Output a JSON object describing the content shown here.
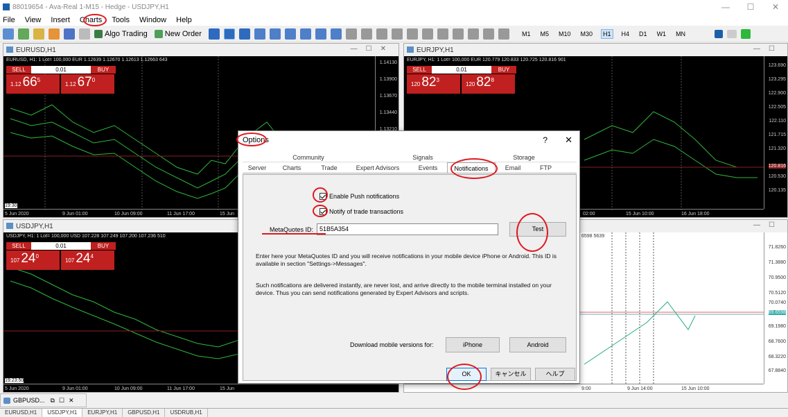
{
  "titlebar": {
    "title": "88019654 - Ava-Real 1-M15 - Hedge - USDJPY,H1",
    "minimize": "—",
    "maximize": "☐",
    "close": "✕"
  },
  "menu": [
    "File",
    "View",
    "Insert",
    "Charts",
    "Tools",
    "Window",
    "Help"
  ],
  "toolbar": {
    "algo_trading": "Algo Trading",
    "new_order": "New Order",
    "timeframes": [
      "M1",
      "M5",
      "M10",
      "M30",
      "H1",
      "H4",
      "D1",
      "W1",
      "MN"
    ],
    "active_timeframe": "H1"
  },
  "charts": {
    "eurusd": {
      "title": "EURUSD,H1",
      "info": "EURUSD, H1: 1 Lot= 100,000 EUR  1.12639 1.12670 1.12613 1.12663  643",
      "sell": "SELL",
      "buy": "BUY",
      "lot": "0.01",
      "bid_small": "1.12",
      "bid_big": "66",
      "bid_sup": "5",
      "ask_small": "1.12",
      "ask_big": "67",
      "ask_sup": "0",
      "yticks": [
        "1.14130",
        "1.13900",
        "1.13670",
        "1.13440",
        "1.13210"
      ],
      "xticks": [
        "5 Jun 2020",
        "9 Jun 01:00",
        "10 Jun 09:00",
        "11 Jun 17:00",
        "15 Jun"
      ],
      "cursor_time": "19:30"
    },
    "eurjpy": {
      "title": "EURJPY,H1",
      "info": "EURJPY, H1: 1 Lot= 100,000 EUR  120.779 120.833 120.725 120.816  901",
      "sell": "SELL",
      "buy": "BUY",
      "lot": "0.01",
      "bid_small": "120",
      "bid_big": "82",
      "bid_sup": "3",
      "ask_small": "120",
      "ask_big": "82",
      "ask_sup": "8",
      "yticks": [
        "123.690",
        "123.295",
        "122.900",
        "122.505",
        "122.110",
        "121.715",
        "121.320",
        "120.816",
        "120.530",
        "120.135"
      ],
      "xticks": [
        "02:00",
        "15 Jun 10:00",
        "16 Jun 18:00"
      ]
    },
    "usdjpy": {
      "title": "USDJPY,H1",
      "info": "USDJPY, H1: 1 Lot= 100,000 USD  107.228 107.249 107.200 107.236  510",
      "sell": "SELL",
      "buy": "BUY",
      "lot": "0.01",
      "bid_small": "107",
      "bid_big": "24",
      "bid_sup": "0",
      "ask_small": "107",
      "ask_big": "24",
      "ask_sup": "4",
      "xticks": [
        "5 Jun 2020",
        "9 Jun 01:00",
        "10 Jun 09:00",
        "11 Jun 17:00",
        "15 Jun"
      ],
      "cursor_time": "19:23:50"
    },
    "fourth": {
      "info": "6598  5639",
      "yticks": [
        "71.8260",
        "71.3880",
        "70.9500",
        "70.5120",
        "70.0740",
        "69.6598",
        "69.1980",
        "68.7600",
        "68.3220",
        "67.8840"
      ],
      "xticks": [
        "9:00",
        "9 Jun 14:00",
        "15 Jun 10:00"
      ]
    }
  },
  "dialog": {
    "title": "Options",
    "help": "?",
    "close": "✕",
    "tabs_top": [
      "Community",
      "Signals",
      "Storage"
    ],
    "tabs": [
      "Server",
      "Charts",
      "Trade",
      "Expert Advisors",
      "Events",
      "Notifications",
      "Email",
      "FTP"
    ],
    "active_tab": "Notifications",
    "enable_push": "Enable Push notifications",
    "notify_trade": "Notify of trade transactions",
    "metaquotes_label": "MetaQuotes ID:",
    "metaquotes_value": "51B5A354",
    "test_button": "Test",
    "para1": "Enter here your MetaQuotes ID and you will receive notifications in your mobile device iPhone or Android. This ID is available in section \"Settings->Messages\".",
    "para2": "Such notifications are delivered instantly, are never lost, and arrive directly to the mobile terminal installed on your device. Thus you can send notifications generated by Expert Advisors and scripts.",
    "download_label": "Download mobile versions for:",
    "iphone": "iPhone",
    "android": "Android",
    "ok": "OK",
    "cancel": "キャンセル",
    "help_btn": "ヘルプ"
  },
  "minimized": {
    "label": "GBPUSD..."
  },
  "bottom_tabs": [
    "EURUSD,H1",
    "USDJPY,H1",
    "EURJPY,H1",
    "GBPUSD,H1",
    "USDRUB,H1"
  ],
  "active_bottom_tab": "USDJPY,H1",
  "colors": {
    "sell_buy": "#c0201f",
    "annotation": "#e0181f",
    "link_blue": "#1b5fa8"
  }
}
